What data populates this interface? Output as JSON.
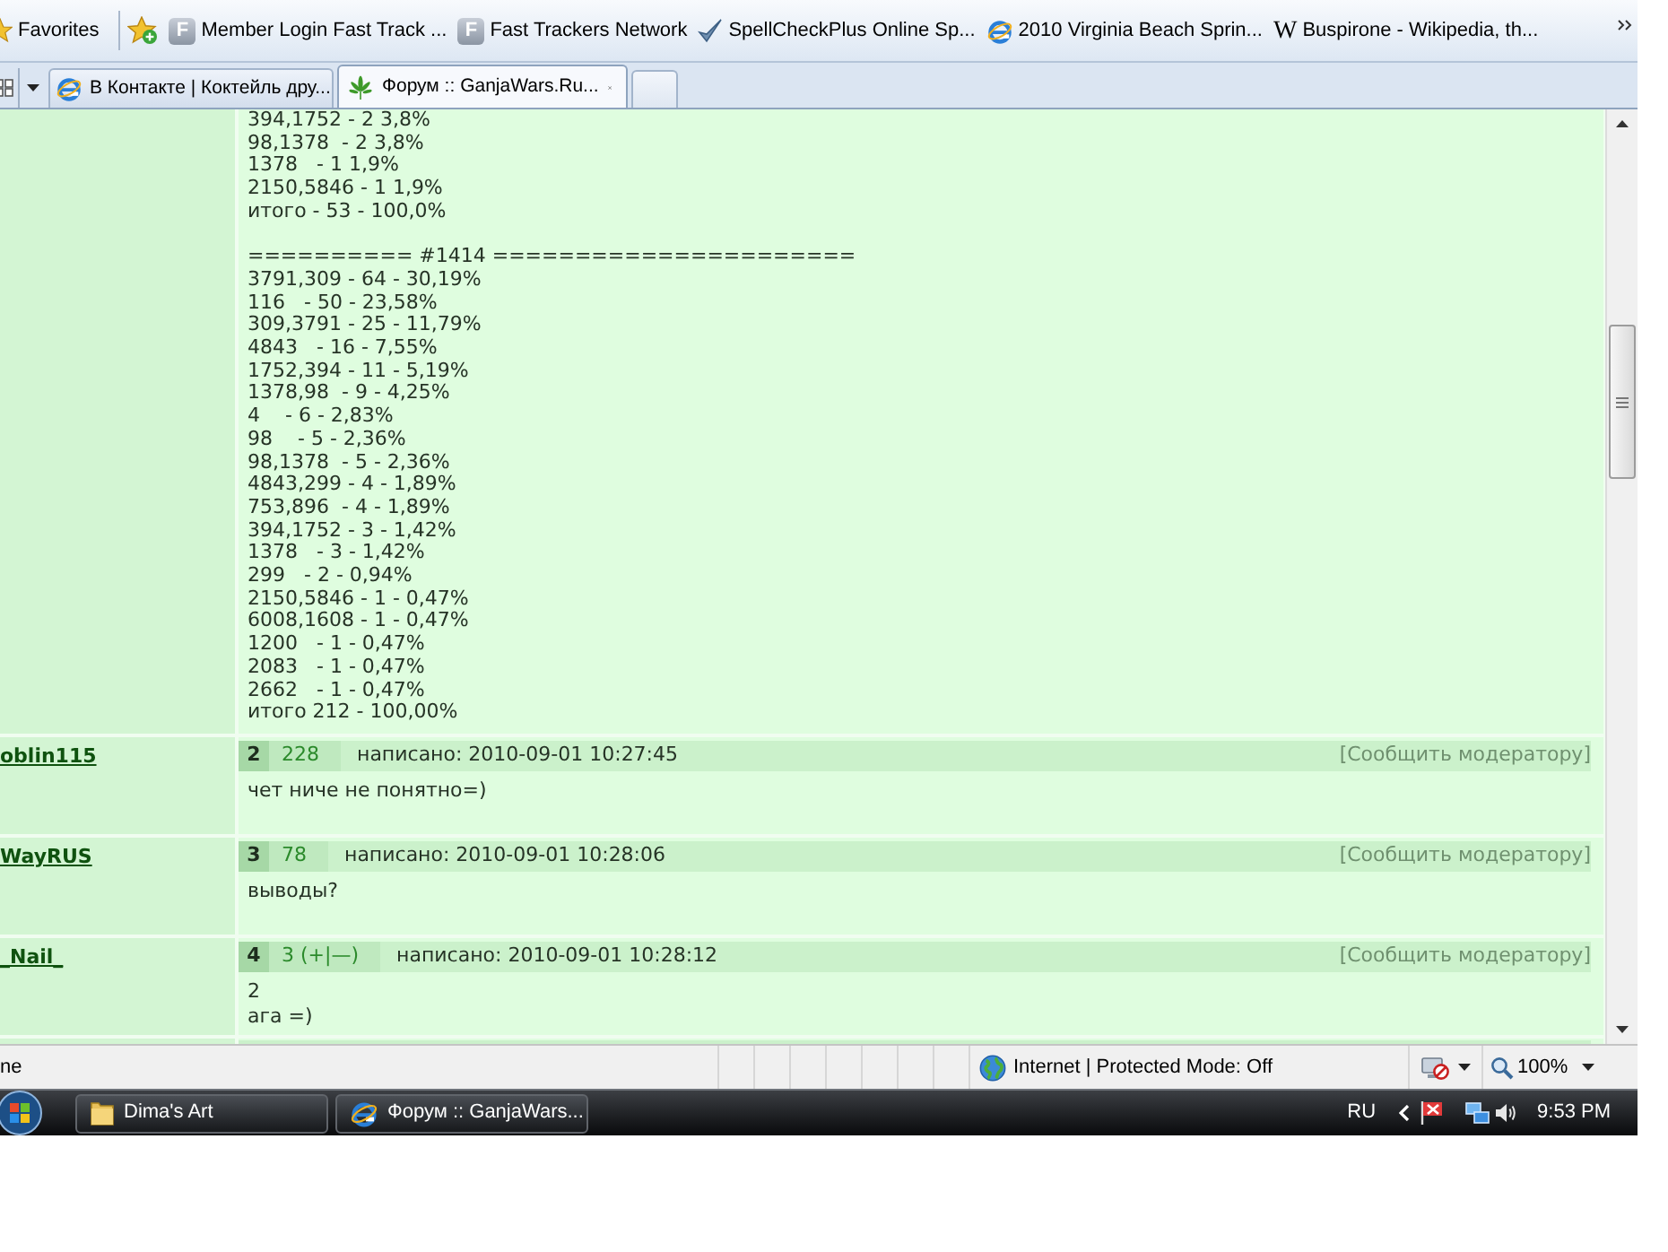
{
  "favorites_bar": {
    "label": "Favorites",
    "links": [
      {
        "kind": "tile",
        "glyph": "F",
        "title": "Member Login Fast Track ..."
      },
      {
        "kind": "tile",
        "glyph": "F",
        "title": "Fast Trackers Network"
      },
      {
        "kind": "shield",
        "title": "SpellCheckPlus Online Sp..."
      },
      {
        "kind": "browser",
        "title": "2010 Virginia Beach Sprin..."
      },
      {
        "kind": "letter",
        "glyph": "W",
        "title": "Buspirone - Wikipedia, th..."
      }
    ]
  },
  "tabs": [
    {
      "kind": "browser",
      "title": "В Контакте | Коктейль дру...",
      "selected": false
    },
    {
      "kind": "leaf",
      "title": "Форум :: GanjaWars.Ru...",
      "selected": true
    }
  ],
  "first_post": {
    "blocks": [
      [
        "394,1752 - 2 3,8%",
        "98,1378  - 2 3,8%",
        "1378   - 1 1,9%",
        "2150,5846 - 1 1,9%",
        "итого - 53 - 100,0%"
      ],
      [
        "========== #1414 ======================",
        "3791,309 - 64 - 30,19%",
        "116   - 50 - 23,58%",
        "309,3791 - 25 - 11,79%",
        "4843   - 16 - 7,55%",
        "1752,394 - 11 - 5,19%",
        "1378,98  - 9 - 4,25%",
        "4    - 6 - 2,83%",
        "98    - 5 - 2,36%",
        "98,1378  - 5 - 2,36%",
        "4843,299 - 4 - 1,89%",
        "753,896  - 4 - 1,89%",
        "394,1752 - 3 - 1,42%",
        "1378   - 3 - 1,42%",
        "299   - 2 - 0,94%",
        "2150,5846 - 1 - 0,47%",
        "6008,1608 - 1 - 0,47%",
        "1200   - 1 - 0,47%",
        "2083   - 1 - 0,47%",
        "2662   - 1 - 0,47%",
        "итого 212 - 100,00%"
      ]
    ]
  },
  "posts": [
    {
      "author": "oblin115",
      "number": "2",
      "rating": "228",
      "posted": "написано: 2010-09-01 10:27:45",
      "report": "[Сообщить модератору]",
      "lines": [
        "чет ниче не понятно=)"
      ]
    },
    {
      "author": "WayRUS",
      "number": "3",
      "rating": "78",
      "posted": "написано: 2010-09-01 10:28:06",
      "report": "[Сообщить модератору]",
      "lines": [
        "выводы?"
      ]
    },
    {
      "author": "_Nail_",
      "number": "4",
      "rating": "3 (+|—)",
      "posted": "написано: 2010-09-01 10:28:12",
      "report": "[Сообщить модератору]",
      "lines": [
        "2",
        "ага =)"
      ]
    }
  ],
  "status_bar": {
    "status": "ne",
    "zone": "Internet | Protected Mode: Off",
    "zoom": "100%"
  },
  "taskbar": {
    "buttons": [
      {
        "kind": "folder",
        "label": "Dima's Art"
      },
      {
        "kind": "browser",
        "label": "Форум :: GanjaWars..."
      }
    ],
    "language": "RU",
    "clock": "9:53 PM"
  }
}
